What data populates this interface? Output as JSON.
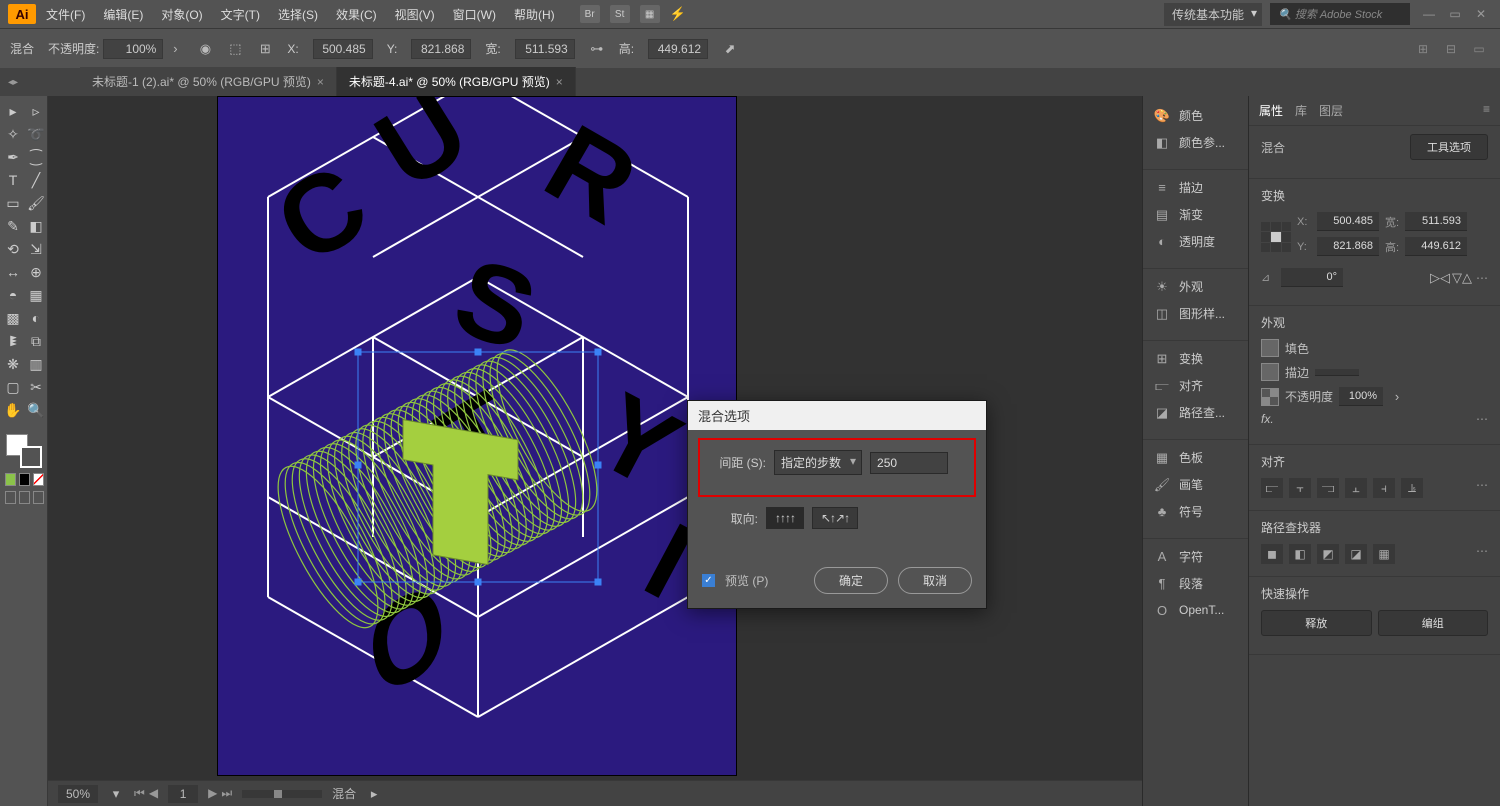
{
  "app": {
    "icon_text": "Ai"
  },
  "menu": {
    "items": [
      "文件(F)",
      "编辑(E)",
      "对象(O)",
      "文字(T)",
      "选择(S)",
      "效果(C)",
      "视图(V)",
      "窗口(W)",
      "帮助(H)"
    ],
    "workspace": "传统基本功能",
    "search_placeholder": "搜索 Adobe Stock"
  },
  "controlbar": {
    "mode": "混合",
    "opacity_label": "不透明度:",
    "opacity_value": "100%",
    "x_label": "X:",
    "x_value": "500.485",
    "y_label": "Y:",
    "y_value": "821.868",
    "w_label": "宽:",
    "w_value": "511.593",
    "h_label": "高:",
    "h_value": "449.612"
  },
  "doctabs": [
    {
      "label": "未标题-1 (2).ai* @ 50% (RGB/GPU 预览)",
      "active": false
    },
    {
      "label": "未标题-4.ai* @ 50% (RGB/GPU 预览)",
      "active": true
    }
  ],
  "dialog": {
    "title": "混合选项",
    "spacing_label": "间距 (S):",
    "spacing_mode": "指定的步数",
    "spacing_value": "250",
    "orientation_label": "取向:",
    "preview_label": "预览 (P)",
    "ok": "确定",
    "cancel": "取消"
  },
  "panel_strip": {
    "items": [
      "颜色",
      "颜色参...",
      "",
      "描边",
      "渐变",
      "透明度",
      "",
      "外观",
      "图形样...",
      "",
      "变换",
      "对齐",
      "路径查...",
      "",
      "色板",
      "画笔",
      "符号",
      "",
      "字符",
      "段落",
      "OpenT..."
    ]
  },
  "props": {
    "tabs": [
      "属性",
      "库",
      "图层"
    ],
    "obj_type": "混合",
    "tool_options_btn": "工具选项",
    "transform_title": "变换",
    "x": "500.485",
    "y": "821.868",
    "w": "511.593",
    "h": "449.612",
    "w_label": "宽:",
    "h_label": "高:",
    "angle": "0°",
    "appearance_title": "外观",
    "fill_label": "填色",
    "stroke_label": "描边",
    "opacity_label": "不透明度",
    "opacity_value": "100%",
    "fx_label": "fx.",
    "align_title": "对齐",
    "pathfinder_title": "路径查找器",
    "quick_title": "快速操作",
    "release_btn": "释放",
    "group_btn": "编组"
  },
  "statusbar": {
    "zoom": "50%",
    "page": "1",
    "tool": "混合"
  }
}
